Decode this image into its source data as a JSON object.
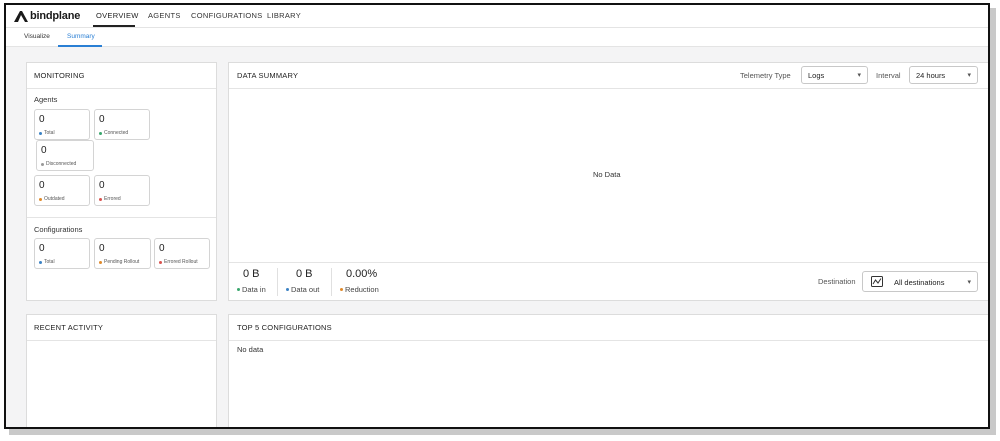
{
  "app": {
    "logo_text": "bindplane"
  },
  "nav": {
    "overview": "OVERVIEW",
    "agents": "AGENTS",
    "configurations": "CONFIGURATIONS",
    "library": "LIBRARY"
  },
  "subnav": {
    "visualize": "Visualize",
    "summary": "Summary"
  },
  "monitoring": {
    "title": "MONITORING",
    "agents_label": "Agents",
    "agents": {
      "total": {
        "value": "0",
        "label": "Total"
      },
      "connected": {
        "value": "0",
        "label": "Connected"
      },
      "disconnected": {
        "value": "0",
        "label": "Disconnected"
      },
      "outdated": {
        "value": "0",
        "label": "Outdated"
      },
      "errored": {
        "value": "0",
        "label": "Errored"
      }
    },
    "configurations_label": "Configurations",
    "configurations": {
      "total": {
        "value": "0",
        "label": "Total"
      },
      "pending": {
        "value": "0",
        "label": "Pending Rollout"
      },
      "errored": {
        "value": "0",
        "label": "Errored Rollout"
      }
    }
  },
  "data_summary": {
    "title": "DATA SUMMARY",
    "telemetry_label": "Telemetry Type",
    "telemetry_value": "Logs",
    "interval_label": "Interval",
    "interval_value": "24 hours",
    "empty_text": "No Data",
    "data_in": {
      "value": "0 B",
      "label": "Data in"
    },
    "data_out": {
      "value": "0 B",
      "label": "Data out"
    },
    "reduction": {
      "value": "0.00%",
      "label": "Reduction"
    },
    "destination_label": "Destination",
    "destination_value": "All destinations"
  },
  "recent_activity": {
    "title": "RECENT ACTIVITY"
  },
  "top_configs": {
    "title": "TOP 5 CONFIGURATIONS",
    "empty_text": "No data"
  },
  "colors": {
    "blue": "#3b82c4",
    "green": "#3aa76d",
    "gray": "#999999",
    "orange": "#e08a2b",
    "red": "#d9534f",
    "accent": "#2a7fd4"
  }
}
